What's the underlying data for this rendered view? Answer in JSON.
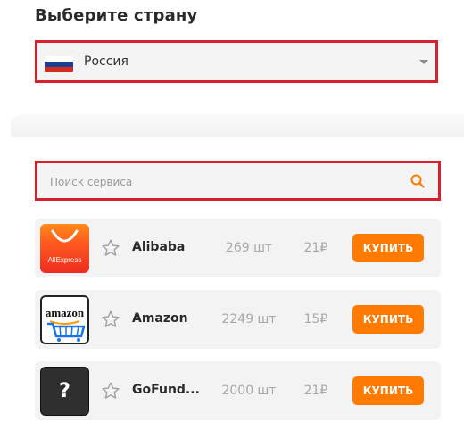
{
  "country": {
    "title": "Выберите страну",
    "selected": "Россия"
  },
  "search": {
    "placeholder": "Поиск сервиса",
    "value": ""
  },
  "services": [
    {
      "name": "Alibaba",
      "count": "269 шт",
      "price": "21₽",
      "buy_label": "КУПИТЬ",
      "logo_text": "AliExpress"
    },
    {
      "name": "Amazon",
      "count": "2249 шт",
      "price": "15₽",
      "buy_label": "КУПИТЬ",
      "logo_text": "amazon"
    },
    {
      "name": "GoFund...",
      "count": "2000 шт",
      "price": "21₽",
      "buy_label": "КУПИТЬ",
      "logo_text": "?"
    }
  ],
  "colors": {
    "accent": "#ff7a00",
    "highlight_border": "#d8202f"
  }
}
